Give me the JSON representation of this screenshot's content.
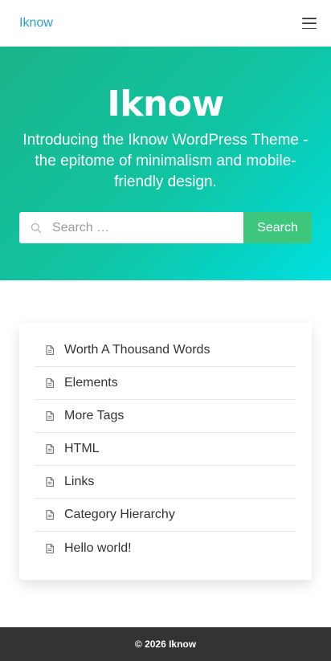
{
  "header": {
    "brand": "Iknow",
    "menu_icon": "hamburger-menu-icon"
  },
  "hero": {
    "title": "Iknow",
    "description": "Introducing the Iknow WordPress Theme - the epitome of minimalism and mobile-friendly design."
  },
  "search": {
    "placeholder": "Search …",
    "value": "",
    "button_label": "Search",
    "icon": "search-icon"
  },
  "posts": {
    "icon": "document-icon",
    "items": [
      {
        "label": "Worth A Thousand Words"
      },
      {
        "label": "Elements"
      },
      {
        "label": "More Tags"
      },
      {
        "label": "HTML"
      },
      {
        "label": "Links"
      },
      {
        "label": "Category Hierarchy"
      },
      {
        "label": "Hello world!"
      }
    ]
  },
  "footer": {
    "copyright": "© 2026 Iknow"
  },
  "colors": {
    "brand_link": "#2a9fd0",
    "hero_gradient_start": "#1bb58a",
    "hero_gradient_end": "#00e0e0",
    "search_button": "#3ec67c",
    "footer_bg": "#333333"
  }
}
